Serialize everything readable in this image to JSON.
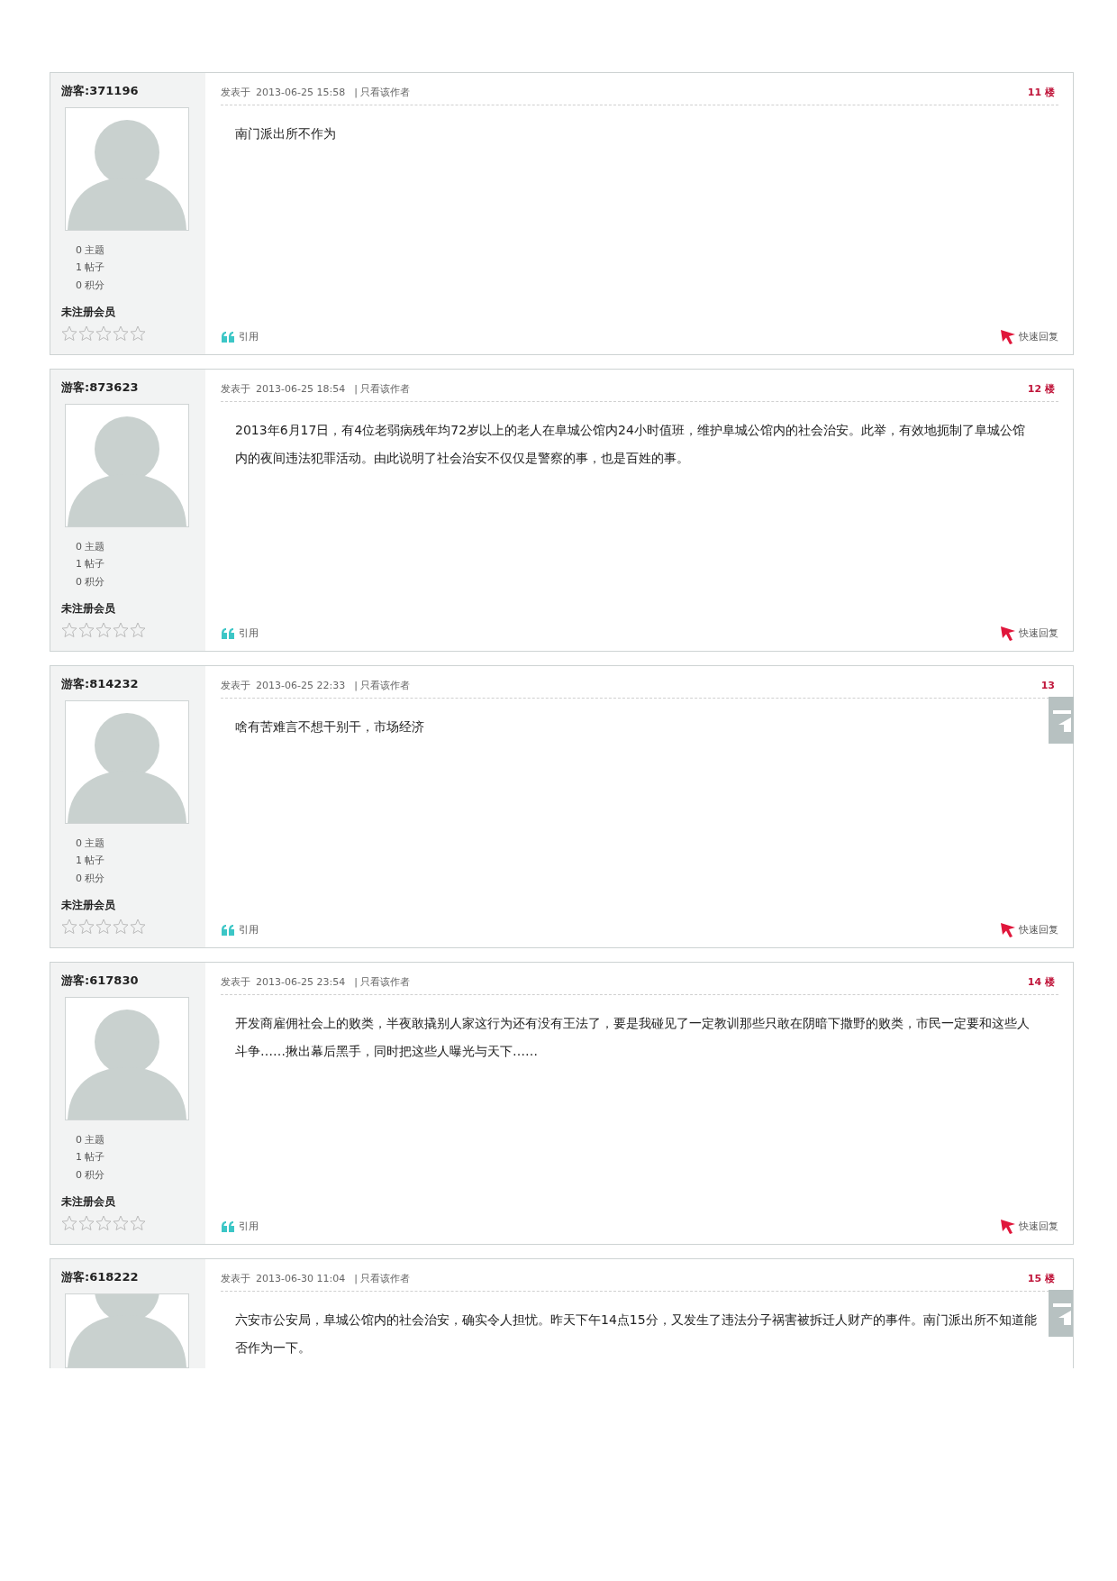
{
  "posts": [
    {
      "kind": "full",
      "user": "游客:371196",
      "posted": "发表于",
      "time": "2013-06-25 15:58",
      "only_author": "| 只看该作者",
      "floor": "11 楼",
      "body": [
        "南门派出所不作为"
      ],
      "stats": [
        "0 主题",
        "1 帖子",
        "0 积分"
      ],
      "rank": "未注册会员",
      "stars": 0,
      "quote": "引用",
      "reply": "快速回复",
      "back_to_top": false
    },
    {
      "kind": "full",
      "user": "游客:873623",
      "posted": "发表于",
      "time": "2013-06-25 18:54",
      "only_author": "| 只看该作者",
      "floor": "12 楼",
      "body": [
        "2013年6月17日，有4位老弱病残年均72岁以上的老人在阜城公馆内24小时值班，维护阜城公馆内的社会治安。此举，有效地扼制了阜城公馆内的夜间违法犯罪活动。由此说明了社会治安不仅仅是警察的事，也是百姓的事。"
      ],
      "stats": [
        "0 主题",
        "1 帖子",
        "0 积分"
      ],
      "rank": "未注册会员",
      "stars": 0,
      "quote": "引用",
      "reply": "快速回复",
      "back_to_top": false
    },
    {
      "kind": "full",
      "user": "游客:814232",
      "posted": "发表于",
      "time": "2013-06-25 22:33",
      "only_author": "| 只看该作者",
      "floor": "13",
      "body": [
        "啥有苦难言不想干别干，市场经济"
      ],
      "stats": [
        "0 主题",
        "1 帖子",
        "0 积分"
      ],
      "rank": "未注册会员",
      "stars": 0,
      "quote": "引用",
      "reply": "快速回复",
      "back_to_top": true
    },
    {
      "kind": "full",
      "user": "游客:617830",
      "posted": "发表于",
      "time": "2013-06-25 23:54",
      "only_author": "| 只看该作者",
      "floor": "14 楼",
      "body": [
        "开发商雇佣社会上的败类，半夜敢撬别人家这行为还有没有王法了，要是我碰见了一定教训那些只敢在阴暗下撒野的败类，市民一定要和这些人斗争……揪出幕后黑手，同时把这些人曝光与天下……"
      ],
      "stats": [
        "0 主题",
        "1 帖子",
        "0 积分"
      ],
      "rank": "未注册会员",
      "stars": 0,
      "quote": "引用",
      "reply": "快速回复",
      "back_to_top": false
    },
    {
      "kind": "cut",
      "user": "游客:618222",
      "posted": "发表于",
      "time": "2013-06-30 11:04",
      "only_author": "| 只看该作者",
      "floor": "15 楼",
      "body": [
        "六安市公安局，阜城公馆内的社会治安，确实令人担忧。昨天下午14点15分，又发生了违法分子祸害被拆迁人财产的事件。南门派出所不知道能否作为一下。"
      ],
      "back_to_top": true
    }
  ]
}
